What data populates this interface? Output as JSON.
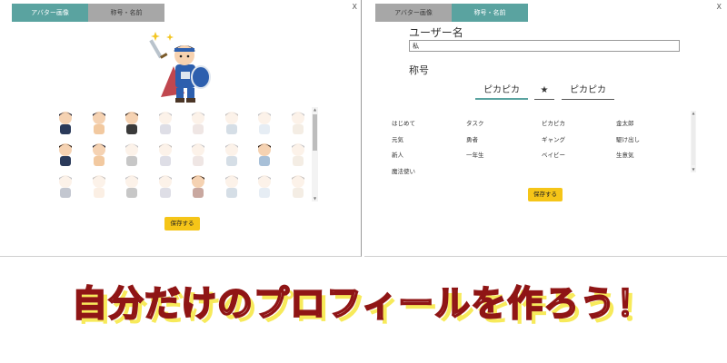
{
  "left_panel": {
    "tabs": [
      {
        "label": "アバター画像",
        "active": true
      },
      {
        "label": "称号・名前",
        "active": false
      }
    ],
    "close_label": "X",
    "hero_icon": "hero-avatar-icon",
    "avatar_grid": [
      {
        "icon": "ninja-icon",
        "selectable": true
      },
      {
        "icon": "boy-icon",
        "selectable": true
      },
      {
        "icon": "girl-icon",
        "selectable": true
      },
      {
        "icon": "shadow-figure-icon",
        "selectable": false
      },
      {
        "icon": "maid-icon",
        "selectable": false
      },
      {
        "icon": "samurai-icon",
        "selectable": false
      },
      {
        "icon": "mage-icon",
        "selectable": false
      },
      {
        "icon": "archer-icon",
        "selectable": false
      },
      {
        "icon": "witch-icon",
        "selectable": true
      },
      {
        "icon": "wizard-icon",
        "selectable": true
      },
      {
        "icon": "pink-character-icon",
        "selectable": false
      },
      {
        "icon": "ninja-warrior-icon",
        "selectable": false
      },
      {
        "icon": "angel-icon",
        "selectable": false
      },
      {
        "icon": "fighter-icon",
        "selectable": false
      },
      {
        "icon": "hero-knight-icon",
        "selectable": true
      },
      {
        "icon": "dragon-icon",
        "selectable": false
      },
      {
        "icon": "pharaoh-icon",
        "selectable": false
      },
      {
        "icon": "ghost-icon",
        "selectable": false
      },
      {
        "icon": "explorer-icon",
        "selectable": false
      },
      {
        "icon": "monk-icon",
        "selectable": false
      },
      {
        "icon": "king-icon",
        "selectable": true
      },
      {
        "icon": "elf-icon",
        "selectable": false
      },
      {
        "icon": "assassin-icon",
        "selectable": false
      },
      {
        "icon": "robot-icon",
        "selectable": false
      }
    ],
    "save_label": "保存する"
  },
  "right_panel": {
    "tabs": [
      {
        "label": "アバター画像",
        "active": false
      },
      {
        "label": "称号・名前",
        "active": true
      }
    ],
    "close_label": "X",
    "username_label": "ユーザー名",
    "username_value": "私",
    "title_label": "称号",
    "title_first": "ピカピカ",
    "title_separator": "★",
    "title_second": "ピカピカ",
    "words": [
      [
        "はじめて",
        "タスク",
        "ピカピカ",
        "金太郎"
      ],
      [
        "元気",
        "勇者",
        "ギャング",
        "駆け出し"
      ],
      [
        "新人",
        "一年生",
        "ベイビー",
        "生意気"
      ],
      [
        "魔法使い"
      ]
    ],
    "save_label": "保存する"
  },
  "banner_text": "自分だけのプロフィールを作ろう！",
  "colors": {
    "tab_active": "#5aa3a0",
    "tab_inactive": "#a7a7a7",
    "save_button": "#f5c518",
    "banner_stroke": "#8f1515",
    "banner_shadow": "#f7ea5a"
  }
}
